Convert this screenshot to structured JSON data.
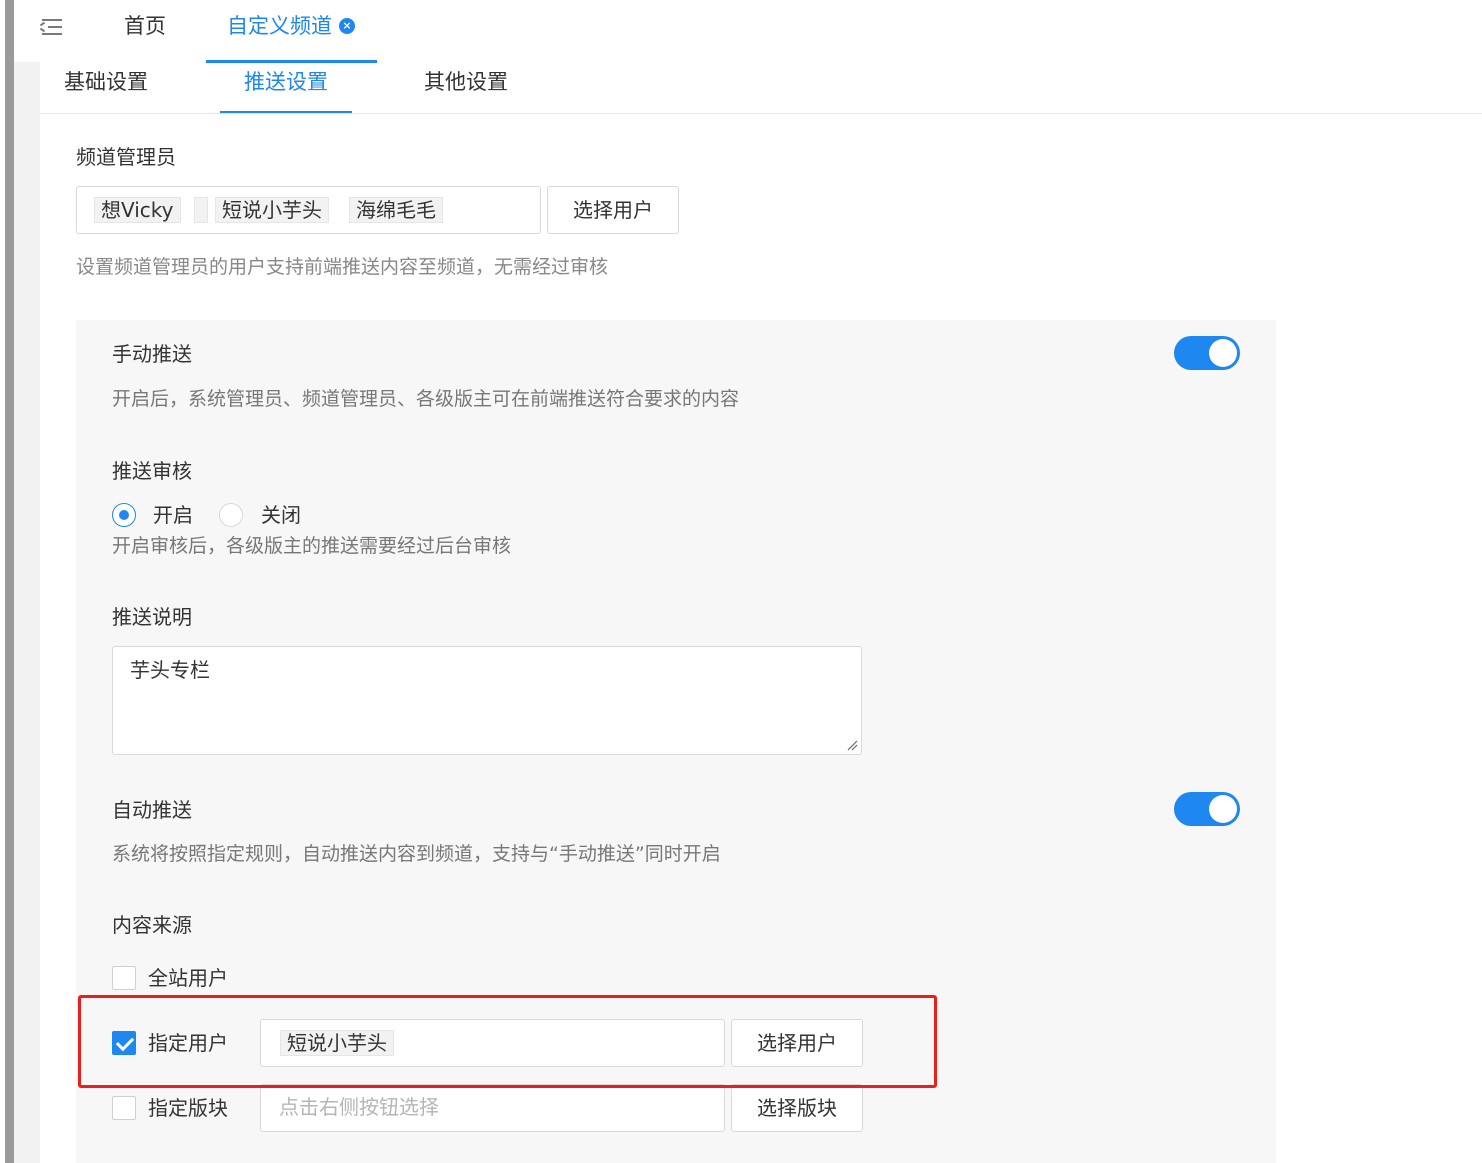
{
  "top_tabs": {
    "home": "首页",
    "custom_channel": "自定义频道",
    "close_glyph": "×"
  },
  "sub_tabs": {
    "basic": "基础设置",
    "push": "推送设置",
    "other": "其他设置"
  },
  "admins": {
    "label": "频道管理员",
    "tags": [
      "想Vicky",
      "",
      "短说小芋头",
      "海绵毛毛"
    ],
    "select_button": "选择用户",
    "hint": "设置频道管理员的用户支持前端推送内容至频道，无需经过审核"
  },
  "manual_push": {
    "label": "手动推送",
    "enabled": true,
    "hint": "开启后，系统管理员、频道管理员、各级版主可在前端推送符合要求的内容"
  },
  "push_review": {
    "label": "推送审核",
    "options": [
      "开启",
      "关闭"
    ],
    "selected": "开启",
    "hint": "开启审核后，各级版主的推送需要经过后台审核"
  },
  "push_note": {
    "label": "推送说明",
    "value": "芋头专栏"
  },
  "auto_push": {
    "label": "自动推送",
    "enabled": true,
    "hint": "系统将按照指定规则，自动推送内容到频道，支持与“手动推送”同时开启"
  },
  "content_source": {
    "label": "内容来源",
    "all_users": {
      "label": "全站用户",
      "checked": false
    },
    "specified_users": {
      "label": "指定用户",
      "checked": true,
      "tags": [
        "短说小芋头"
      ],
      "button": "选择用户"
    },
    "specified_blocks": {
      "label": "指定版块",
      "checked": false,
      "placeholder": "点击右侧按钮选择",
      "button": "选择版块"
    }
  },
  "colors": {
    "accent": "#1e87f0",
    "highlight": "#e8201b"
  }
}
